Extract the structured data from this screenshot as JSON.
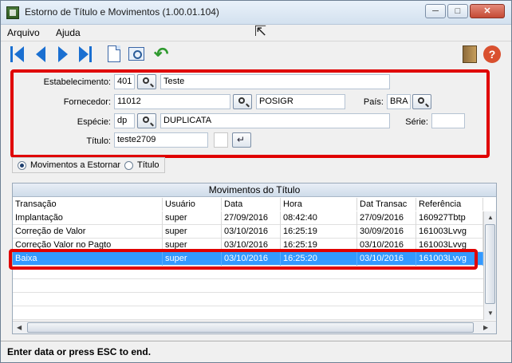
{
  "window": {
    "title": "Estorno de Título e Movimentos (1.00.01.104)",
    "controls": {
      "minimize": "─",
      "maximize": "□",
      "close": "✕"
    }
  },
  "menu": [
    "Arquivo",
    "Ajuda"
  ],
  "toolbar": {
    "icons": [
      "first-record-icon",
      "previous-record-icon",
      "next-record-icon",
      "last-record-icon",
      "new-document-icon",
      "preview-icon",
      "undo-icon",
      "exit-icon",
      "help-icon"
    ],
    "help_glyph": "?",
    "undo_glyph": "↶"
  },
  "form": {
    "estabelecimento": {
      "label": "Estabelecimento:",
      "code": "401",
      "name": "Teste"
    },
    "fornecedor": {
      "label": "Fornecedor:",
      "code": "11012",
      "name": "POSIGR"
    },
    "pais": {
      "label": "País:",
      "value": "BRA"
    },
    "especie": {
      "label": "Espécie:",
      "code": "dp",
      "name": "DUPLICATA"
    },
    "serie": {
      "label": "Série:",
      "value": ""
    },
    "titulo": {
      "label": "Título:",
      "value": "teste2709",
      "extra": ""
    },
    "enter_glyph": "↵"
  },
  "radio": {
    "options": [
      "Movimentos a Estornar",
      "Título"
    ],
    "selected_index": 0
  },
  "table": {
    "title": "Movimentos do Título",
    "columns": [
      "Transação",
      "Usuário",
      "Data",
      "Hora",
      "Dat Transac",
      "Referência"
    ],
    "rows": [
      [
        "Implantação",
        "super",
        "27/09/2016",
        "08:42:40",
        "27/09/2016",
        "160927Tbtp"
      ],
      [
        "Correção de Valor",
        "super",
        "03/10/2016",
        "16:25:19",
        "30/09/2016",
        "161003Lvvg"
      ],
      [
        "Correção Valor no Pagto",
        "super",
        "03/10/2016",
        "16:25:19",
        "03/10/2016",
        "161003Lvvg"
      ],
      [
        "Baixa",
        "super",
        "03/10/2016",
        "16:25:20",
        "03/10/2016",
        "161003Lvvg"
      ]
    ],
    "selected_row_index": 3,
    "scroll_arrows": {
      "up": "▲",
      "down": "▼",
      "left": "◀",
      "right": "▶"
    }
  },
  "status_bar": "Enter data or press ESC to end.",
  "colors": {
    "highlight_frame": "#e00000",
    "selection": "#3399ff"
  }
}
